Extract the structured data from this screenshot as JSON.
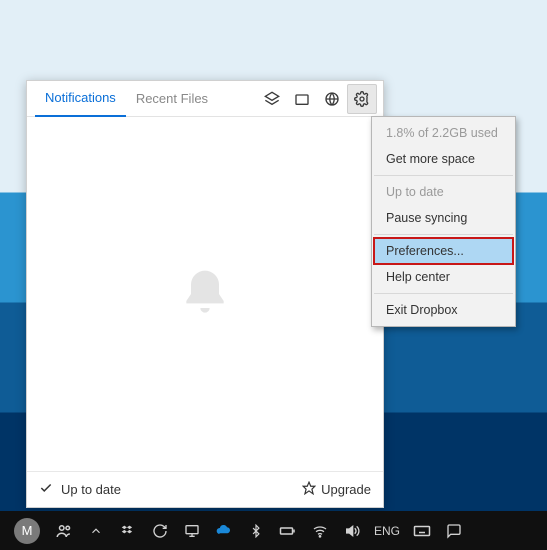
{
  "panel": {
    "tabs": {
      "notifications": "Notifications",
      "recent": "Recent Files"
    },
    "footer": {
      "status": "Up to date",
      "upgrade": "Upgrade"
    }
  },
  "menu": {
    "usage": "1.8% of 2.2GB used",
    "get_space": "Get more space",
    "status": "Up to date",
    "pause": "Pause syncing",
    "prefs": "Preferences...",
    "help": "Help center",
    "exit": "Exit Dropbox"
  },
  "taskbar": {
    "avatar": "M",
    "lang": "ENG"
  }
}
